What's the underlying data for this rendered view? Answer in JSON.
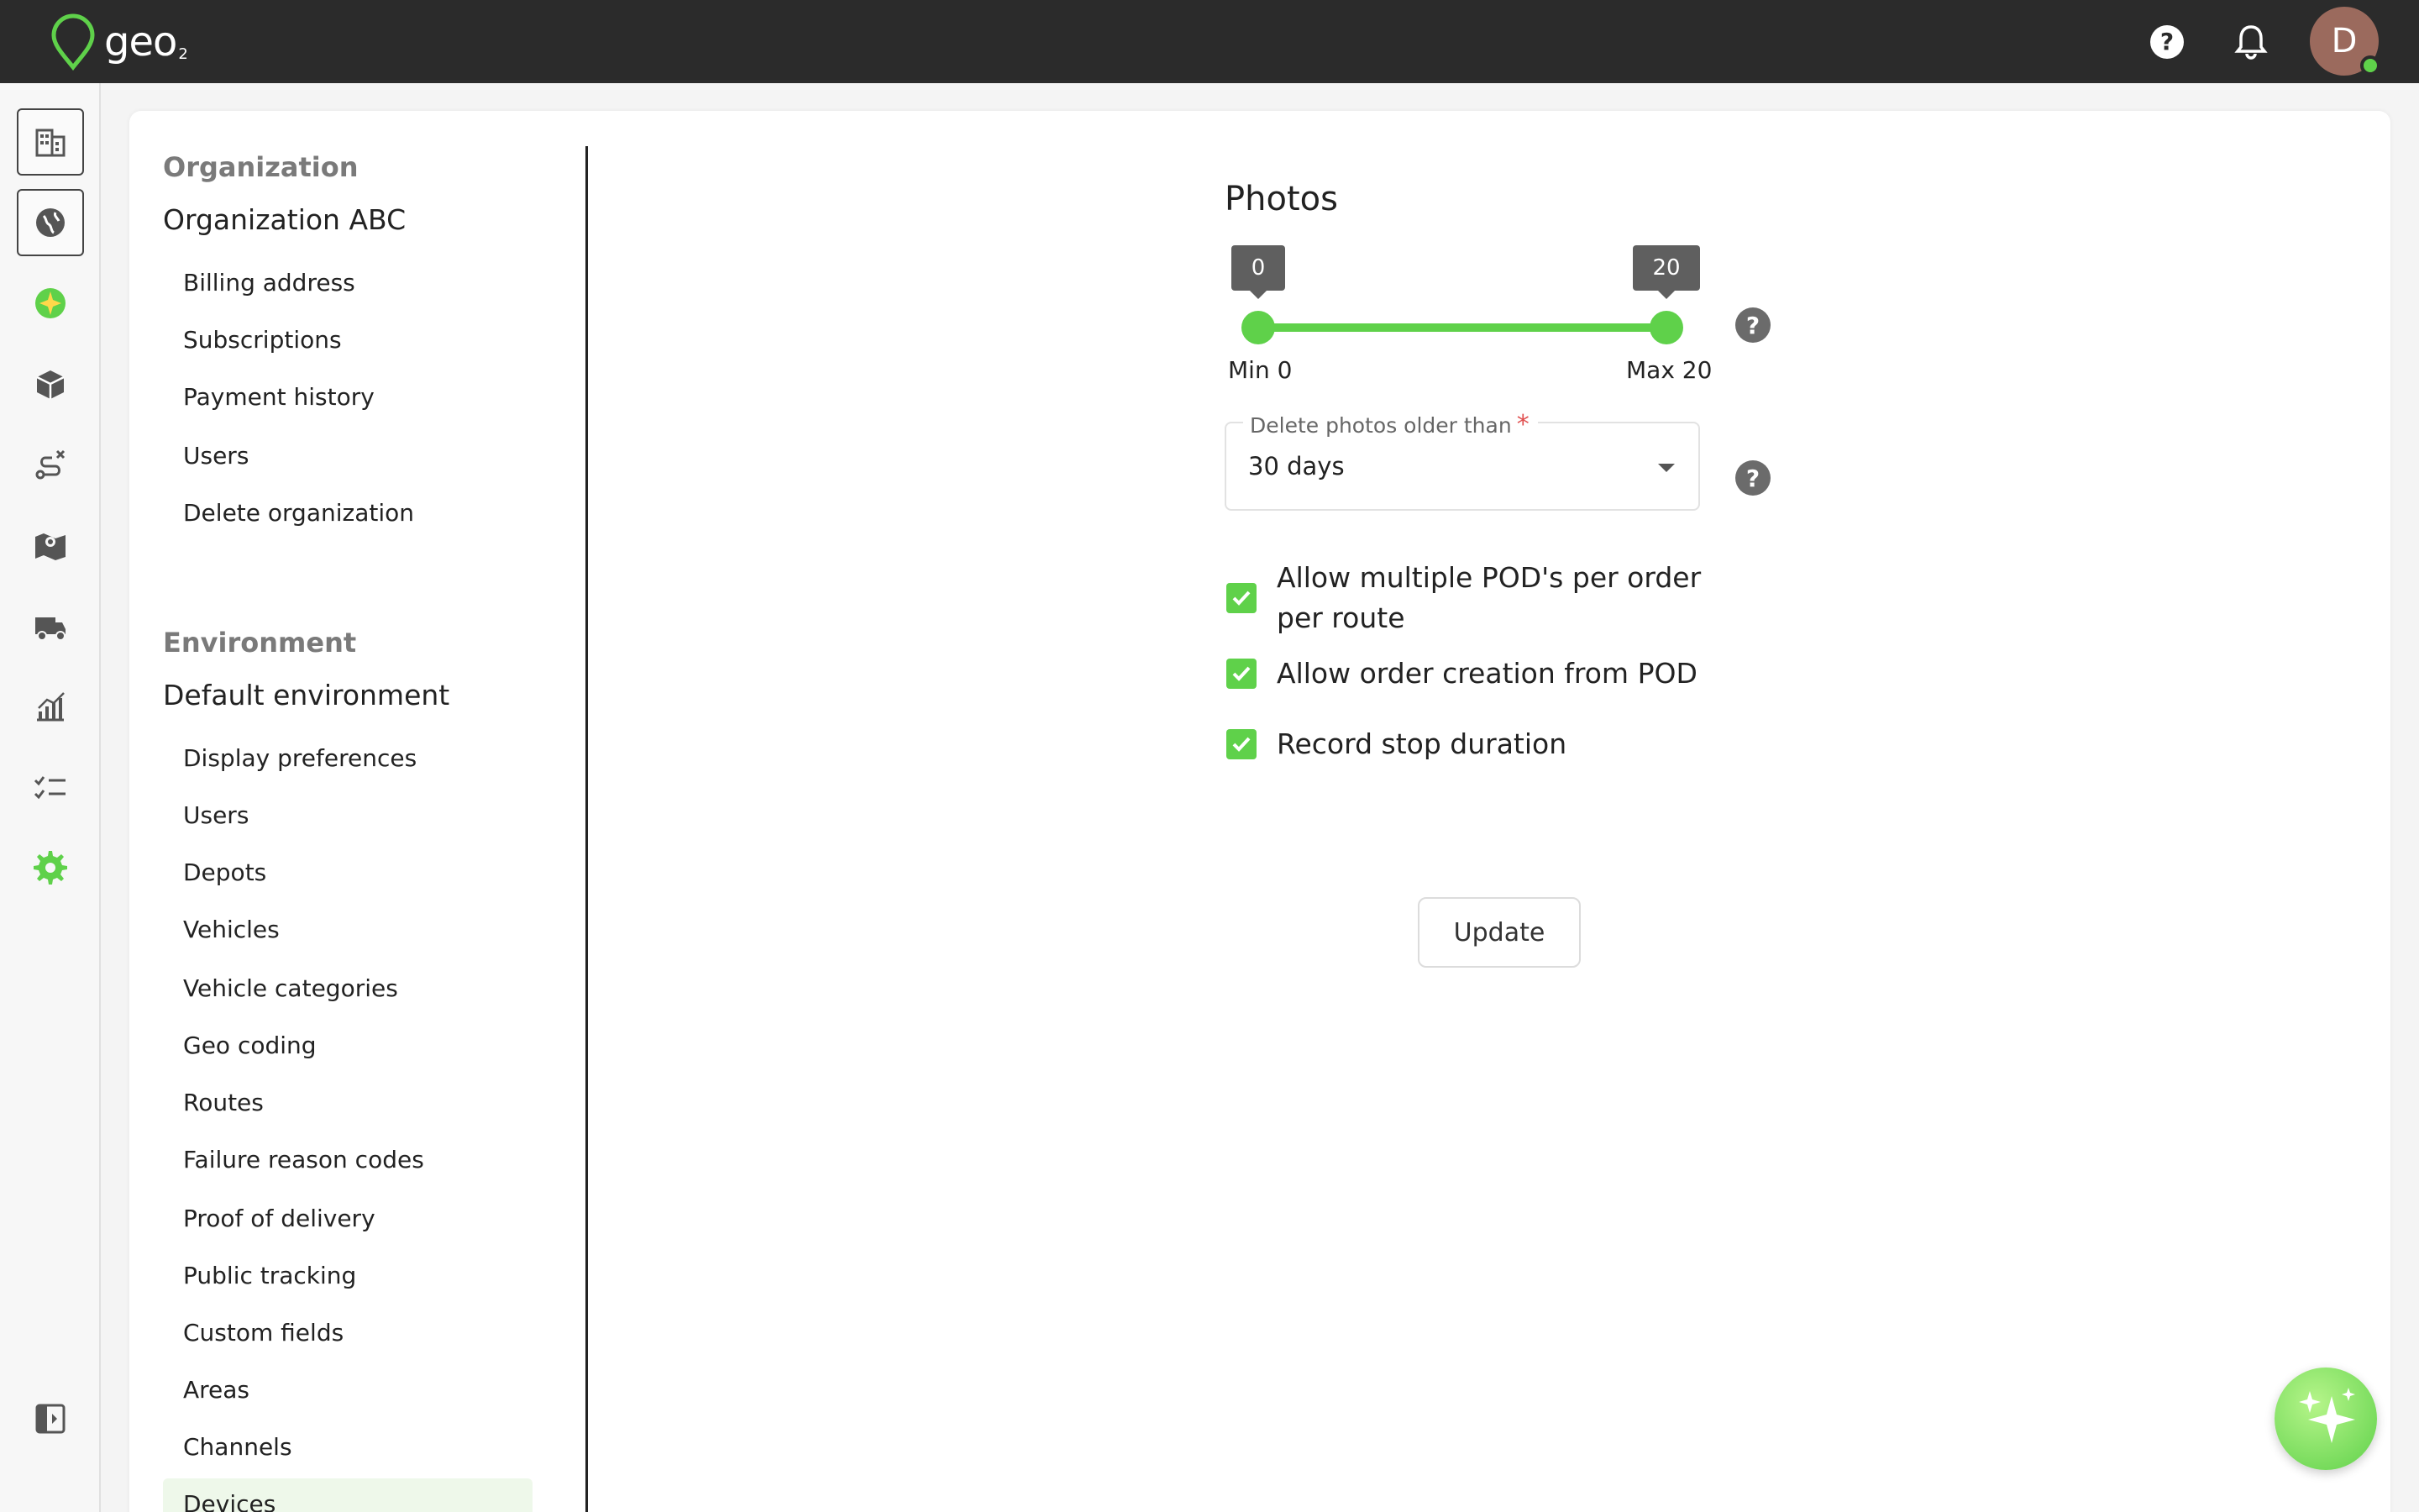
{
  "brand": {
    "name": "geo",
    "sub": "2",
    "accent": "#5fd14a"
  },
  "topbar": {
    "help_icon": "help-circle-icon",
    "bell_icon": "bell-icon",
    "avatar_initial": "D"
  },
  "rail": {
    "items": [
      "building-icon",
      "globe-icon",
      "globe-color-icon",
      "box-icon",
      "route-icon",
      "map-icon",
      "truck-icon",
      "chart-icon",
      "checklist-icon",
      "gear-icon"
    ],
    "collapse_icon": "panel-toggle-icon"
  },
  "nav": {
    "organization_heading": "Organization",
    "organization_name": "Organization ABC",
    "organization_items": [
      "Billing address",
      "Subscriptions",
      "Payment history",
      "Users",
      "Delete organization"
    ],
    "environment_heading": "Environment",
    "environment_name": "Default environment",
    "environment_items": [
      "Display preferences",
      "Users",
      "Depots",
      "Vehicles",
      "Vehicle categories",
      "Geo coding",
      "Routes",
      "Failure reason codes",
      "Proof of delivery",
      "Public tracking",
      "Custom fields",
      "Areas",
      "Channels",
      "Devices"
    ]
  },
  "photos": {
    "title": "Photos",
    "slider": {
      "min_value": "0",
      "max_value": "20",
      "min_label": "Min 0",
      "max_label": "Max 20"
    },
    "delete_label": "Delete photos older than",
    "delete_required": "*",
    "delete_value": "30 days",
    "options": [
      {
        "label": "Allow multiple POD's per order per route",
        "checked": true
      },
      {
        "label": "Allow order creation from POD",
        "checked": true
      },
      {
        "label": "Record stop duration",
        "checked": true
      }
    ],
    "update_label": "Update"
  },
  "fab": {
    "icon": "sparkle-icon"
  }
}
